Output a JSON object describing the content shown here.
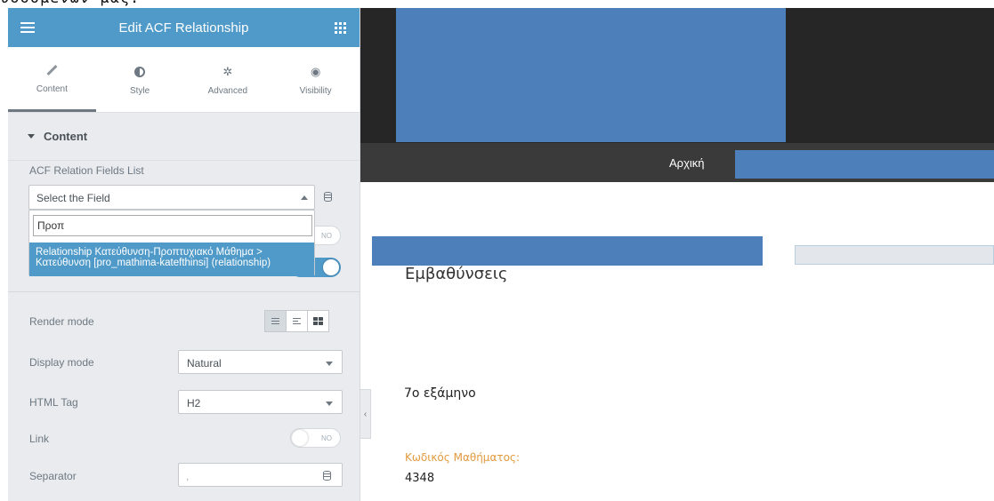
{
  "top_text": "υσσόμενων μας.",
  "panel": {
    "title": "Edit ACF Relationship",
    "tabs": [
      {
        "label": "Content",
        "icon": "pencil-icon"
      },
      {
        "label": "Style",
        "icon": "contrast-icon"
      },
      {
        "label": "Advanced",
        "icon": "gear-icon"
      },
      {
        "label": "Visibility",
        "icon": "eye-icon"
      }
    ],
    "section_title": "Content",
    "fields_list_label": "ACF Relation Fields List",
    "select_value": "Select the Field",
    "search_value": "Προπ",
    "dropdown_option": "Relationship Κατεύθυνση-Προπτυχιακό Μάθημα > Κατεύθυνση [pro_mathima-katefthinsi] (relationship)",
    "toggle_no": "NO",
    "render_mode_label": "Render mode",
    "display_mode_label": "Display mode",
    "display_mode_value": "Natural",
    "html_tag_label": "HTML Tag",
    "html_tag_value": "H2",
    "link_label": "Link",
    "link_toggle": "NO",
    "separator_label": "Separator",
    "separator_value": ","
  },
  "site": {
    "nav_item": "Αρχική",
    "heading": "Εμβαθύνσεις",
    "semester": "7ο εξάμηνο",
    "code_label": "Κωδικός Μαθήματος:",
    "code_value": "4348"
  },
  "colors": {
    "accent": "#4f9ac9",
    "site_blue": "#4d80bb",
    "code_label": "#e29a3f"
  }
}
